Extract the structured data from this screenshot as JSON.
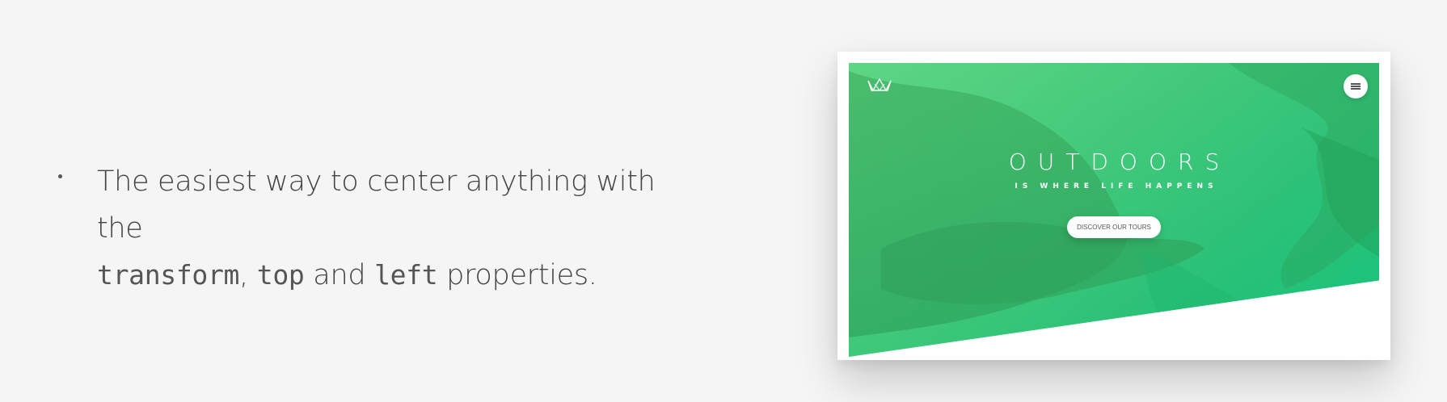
{
  "slide": {
    "bullet": {
      "text_before": "The easiest way to center anything with the",
      "code_1": "transform",
      "comma": ", ",
      "code_2": "top",
      "and": " and ",
      "code_3": "left",
      "text_after": " properties."
    }
  },
  "preview": {
    "logo_icon": "crown-logo-icon",
    "menu_icon": "hamburger-menu-icon",
    "title": "OUTDOORS",
    "subtitle": "IS WHERE LIFE HAPPENS",
    "cta_label": "DISCOVER OUR TOURS",
    "colors": {
      "hero_gradient_start": "#5ad27a",
      "hero_gradient_end": "#13c07a",
      "background": "#f5f5f5"
    }
  }
}
